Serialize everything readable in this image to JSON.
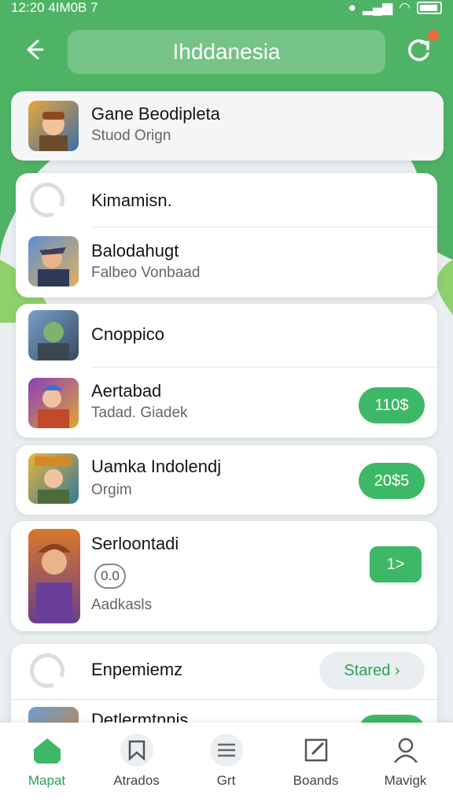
{
  "status_bar": {
    "time": "12:20 4IM0B 7"
  },
  "header": {
    "title": "Ihddanesia"
  },
  "colors": {
    "accent": "#4fb366",
    "button": "#3db866"
  },
  "list": [
    {
      "name": "Gane Beodipleta",
      "subtitle": "Stuod Orign"
    },
    {
      "name": "Kimamisn."
    },
    {
      "name": "Balodahugt",
      "subtitle": "Falbeo Vonbaad"
    },
    {
      "name": "Cnoppico"
    },
    {
      "name": "Aertabad",
      "subtitle": "Tadad. Giadek",
      "action": "110$"
    },
    {
      "name": "Uamka Indolendj",
      "subtitle": "Orgim",
      "action": "20$5"
    },
    {
      "name": "Serloontadi",
      "badge": "0.0",
      "subtitle": "Aadkasls",
      "action": "1>"
    },
    {
      "name": "Enpemiemz",
      "action": "Stared"
    },
    {
      "name": "Detlermtnnis"
    }
  ],
  "tabs": [
    {
      "label": "Mapat",
      "icon": "home-icon"
    },
    {
      "label": "Atrados",
      "icon": "bookmark-icon"
    },
    {
      "label": "Grt",
      "icon": "list-icon"
    },
    {
      "label": "Boands",
      "icon": "edit-icon"
    },
    {
      "label": "Mavigk",
      "icon": "profile-icon"
    }
  ]
}
